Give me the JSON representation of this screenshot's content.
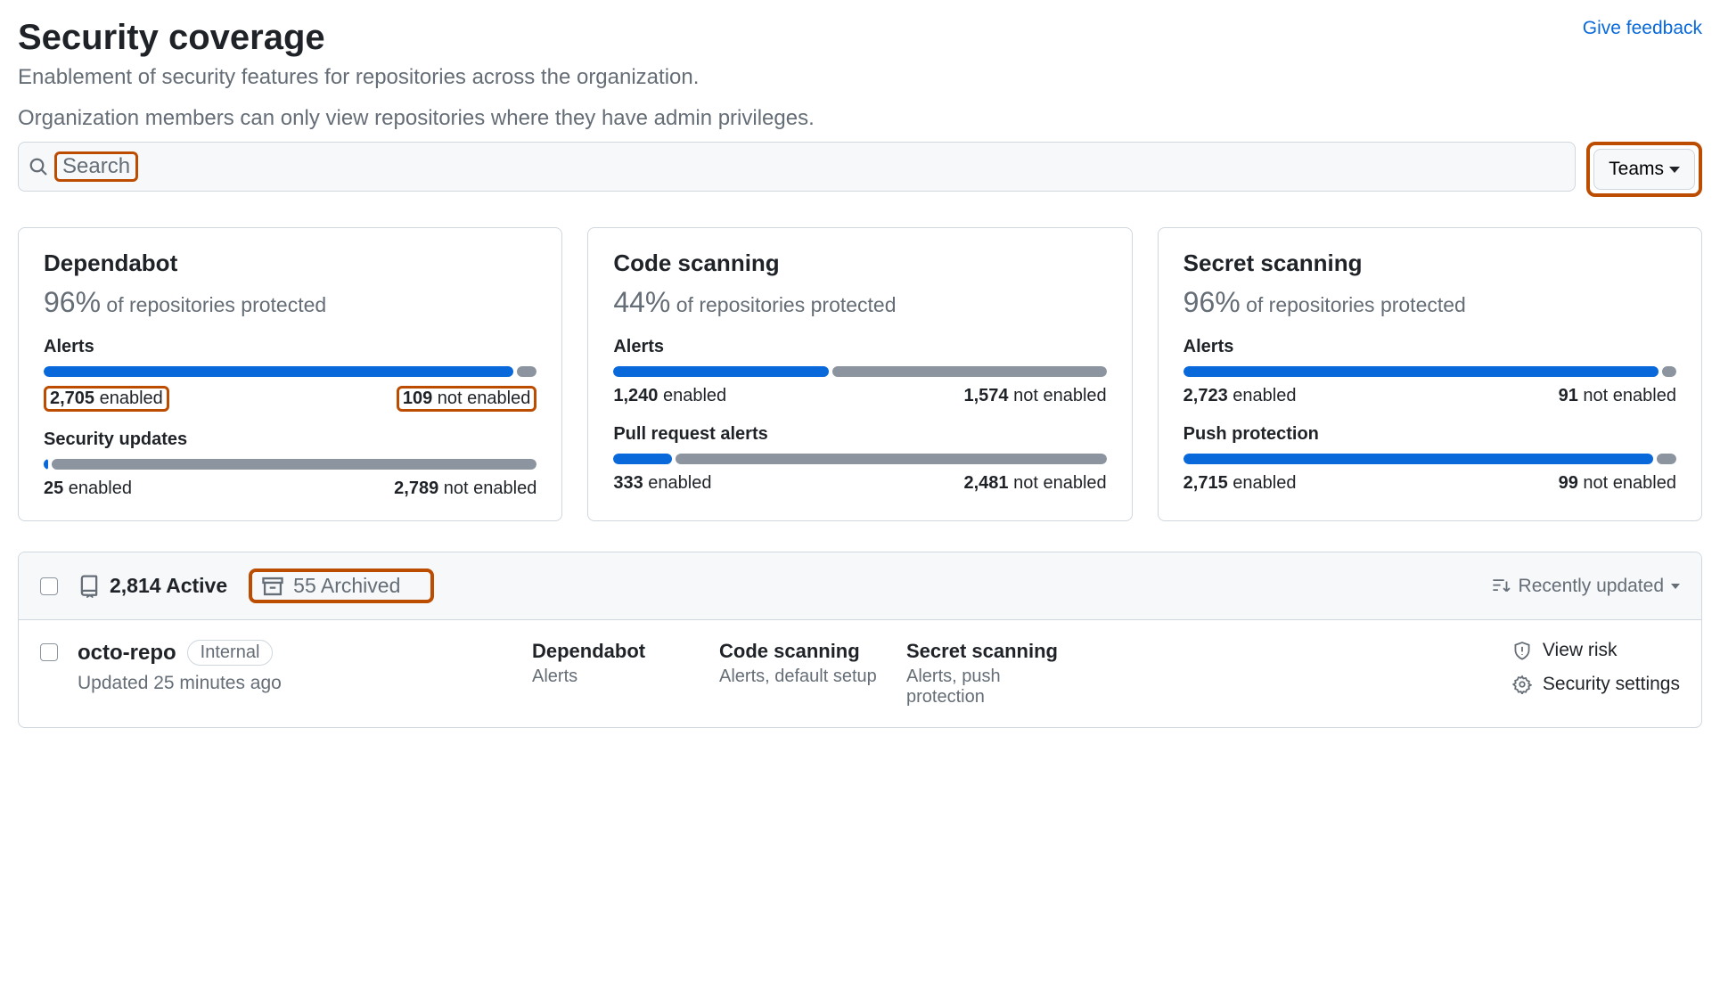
{
  "header": {
    "title": "Security coverage",
    "feedback": "Give feedback",
    "subtitle": "Enablement of security features for repositories across the organization.",
    "note": "Organization members can only view repositories where they have admin privileges."
  },
  "search": {
    "placeholder": "Search",
    "teams_label": "Teams"
  },
  "cards": [
    {
      "title": "Dependabot",
      "pct": "96%",
      "pct_suffix": "of repositories protected",
      "metrics": [
        {
          "label": "Alerts",
          "enabled_n": "2,705",
          "enabled_t": "enabled",
          "not_n": "109",
          "not_t": "not enabled",
          "pct": 96,
          "highlight": true
        },
        {
          "label": "Security updates",
          "enabled_n": "25",
          "enabled_t": "enabled",
          "not_n": "2,789",
          "not_t": "not enabled",
          "pct": 1,
          "highlight": false
        }
      ]
    },
    {
      "title": "Code scanning",
      "pct": "44%",
      "pct_suffix": "of repositories protected",
      "metrics": [
        {
          "label": "Alerts",
          "enabled_n": "1,240",
          "enabled_t": "enabled",
          "not_n": "1,574",
          "not_t": "not enabled",
          "pct": 44,
          "highlight": false
        },
        {
          "label": "Pull request alerts",
          "enabled_n": "333",
          "enabled_t": "enabled",
          "not_n": "2,481",
          "not_t": "not enabled",
          "pct": 12,
          "highlight": false
        }
      ]
    },
    {
      "title": "Secret scanning",
      "pct": "96%",
      "pct_suffix": "of repositories protected",
      "metrics": [
        {
          "label": "Alerts",
          "enabled_n": "2,723",
          "enabled_t": "enabled",
          "not_n": "91",
          "not_t": "not enabled",
          "pct": 97,
          "highlight": false
        },
        {
          "label": "Push protection",
          "enabled_n": "2,715",
          "enabled_t": "enabled",
          "not_n": "99",
          "not_t": "not enabled",
          "pct": 96,
          "highlight": false
        }
      ]
    }
  ],
  "list": {
    "active_count": "2,814",
    "active_label": "Active",
    "archived_count": "55",
    "archived_label": "Archived",
    "sort_label": "Recently updated"
  },
  "repo": {
    "name": "octo-repo",
    "visibility": "Internal",
    "updated": "Updated 25 minutes ago",
    "cols": [
      {
        "title": "Dependabot",
        "sub": "Alerts"
      },
      {
        "title": "Code scanning",
        "sub": "Alerts, default setup"
      },
      {
        "title": "Secret scanning",
        "sub": "Alerts, push protection"
      }
    ],
    "actions": {
      "view_risk": "View risk",
      "security_settings": "Security settings"
    }
  }
}
